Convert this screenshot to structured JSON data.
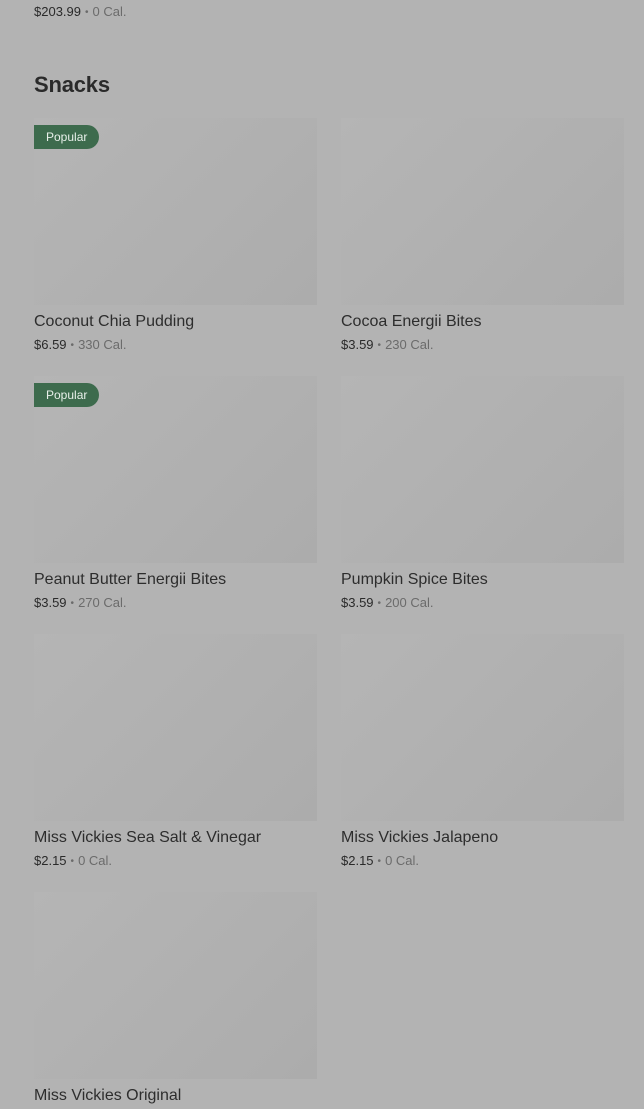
{
  "previous_item": {
    "price": "$203.99",
    "separator": "•",
    "calories": "0 Cal."
  },
  "section": {
    "title": "Snacks"
  },
  "items": [
    {
      "name": "Coconut Chia Pudding",
      "price": "$6.59",
      "separator": "•",
      "calories": "330 Cal.",
      "badge": "Popular"
    },
    {
      "name": "Cocoa Energii Bites",
      "price": "$3.59",
      "separator": "•",
      "calories": "230 Cal.",
      "badge": ""
    },
    {
      "name": "Peanut Butter Energii Bites",
      "price": "$3.59",
      "separator": "•",
      "calories": "270 Cal.",
      "badge": "Popular"
    },
    {
      "name": "Pumpkin Spice Bites",
      "price": "$3.59",
      "separator": "•",
      "calories": "200 Cal.",
      "badge": ""
    },
    {
      "name": "Miss Vickies Sea Salt & Vinegar",
      "price": "$2.15",
      "separator": "•",
      "calories": "0 Cal.",
      "badge": ""
    },
    {
      "name": "Miss Vickies Jalapeno",
      "price": "$2.15",
      "separator": "•",
      "calories": "0 Cal.",
      "badge": ""
    },
    {
      "name": "Miss Vickies Original",
      "price": "",
      "separator": "",
      "calories": "",
      "badge": ""
    }
  ],
  "colors": {
    "background": "#b3b3b3",
    "badge": "#3d6b4d"
  }
}
